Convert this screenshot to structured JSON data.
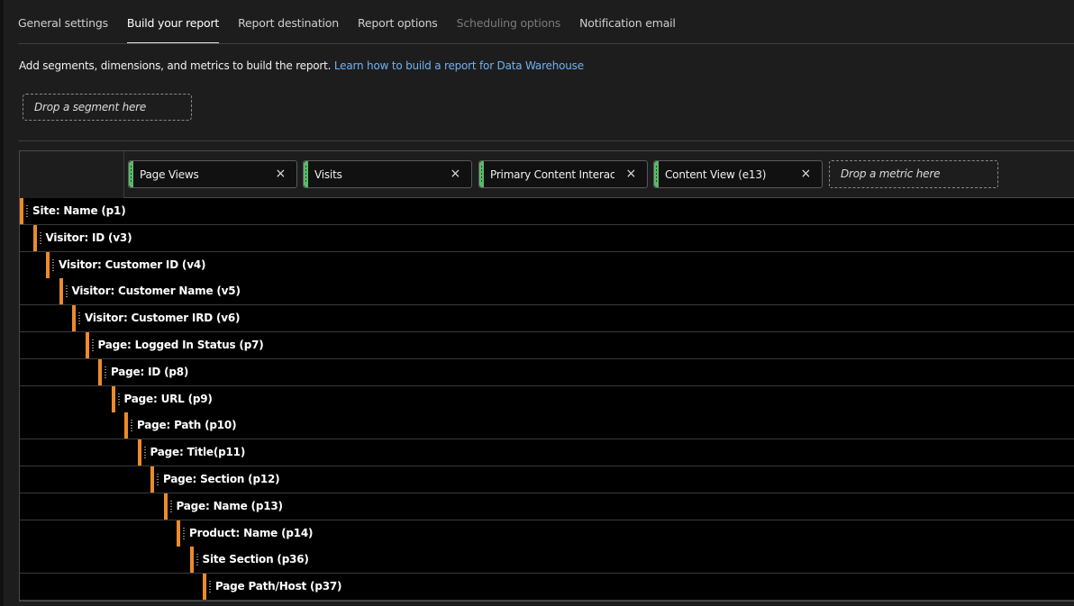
{
  "tabs": [
    {
      "label": "General settings",
      "state": "normal"
    },
    {
      "label": "Build your report",
      "state": "active"
    },
    {
      "label": "Report destination",
      "state": "normal"
    },
    {
      "label": "Report options",
      "state": "normal"
    },
    {
      "label": "Scheduling options",
      "state": "disabled"
    },
    {
      "label": "Notification email",
      "state": "normal"
    }
  ],
  "description": {
    "text": "Add segments, dimensions, and metrics to build the report.",
    "link": "Learn how to build a report for Data Warehouse"
  },
  "segment_drop": {
    "label": "Drop a segment here"
  },
  "metrics": [
    {
      "label": "Page Views"
    },
    {
      "label": "Visits"
    },
    {
      "label": "Primary Content Interact..."
    },
    {
      "label": "Content View (e13)"
    }
  ],
  "metric_drop": {
    "label": "Drop a metric here"
  },
  "close_glyph": "×",
  "dimensions": [
    {
      "label": "Site: Name (p1)"
    },
    {
      "label": "Visitor: ID (v3)"
    },
    {
      "label": "Visitor: Customer ID (v4)"
    },
    {
      "label": "Visitor: Customer Name (v5)"
    },
    {
      "label": "Visitor: Customer IRD (v6)"
    },
    {
      "label": "Page: Logged In Status (p7)"
    },
    {
      "label": "Page: ID (p8)"
    },
    {
      "label": "Page: URL (p9)"
    },
    {
      "label": "Page: Path (p10)"
    },
    {
      "label": "Page: Title(p11)"
    },
    {
      "label": "Page: Section (p12)"
    },
    {
      "label": "Page: Name (p13)"
    },
    {
      "label": "Product: Name (p14)"
    },
    {
      "label": "Site Section (p36)"
    },
    {
      "label": "Page Path/Host (p37)"
    }
  ],
  "colors": {
    "dimension_accent": "#ec8a2c",
    "metric_accent": "#5bb96a",
    "link": "#6fb1f5"
  }
}
